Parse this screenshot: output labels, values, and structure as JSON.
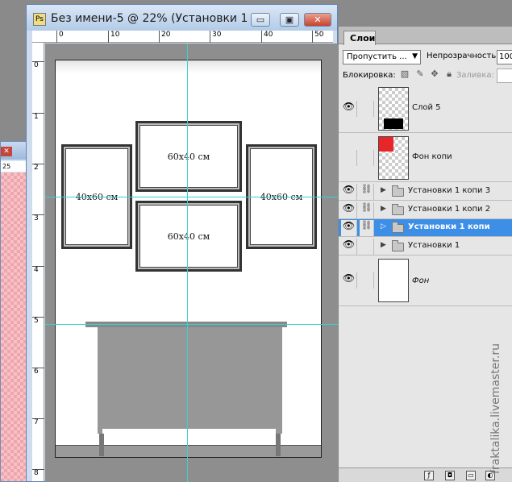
{
  "document": {
    "title": "Без имени-5 @ 22% (Установки 1 ...",
    "minimize_glyph": "▭",
    "maximize_glyph": "▣",
    "close_glyph": "✕",
    "ruler_h": [
      "0",
      "10",
      "20",
      "30",
      "40",
      "50"
    ],
    "ruler_v": [
      "0",
      "1",
      "2",
      "3",
      "4",
      "5",
      "6",
      "7",
      "8"
    ],
    "frames": [
      {
        "label": "40x60 см"
      },
      {
        "label": "60x40 см"
      },
      {
        "label": "60x40 см"
      },
      {
        "label": "40x60 см"
      }
    ]
  },
  "background_window": {
    "close_glyph": "✕",
    "ruler_value": "25"
  },
  "layers_panel": {
    "tab_label": "Слои",
    "blend_mode": "Пропустить ...",
    "opacity_label": "Непрозрачность:",
    "opacity_value": "100",
    "lock_label": "Блокировка:",
    "fill_label": "Заливка:",
    "layers": [
      {
        "name": "Слой 5",
        "visible": true,
        "type": "image",
        "thumb_color": "#000000"
      },
      {
        "name": "Фон копи",
        "visible": false,
        "type": "image",
        "thumb_color": "#e8262a"
      },
      {
        "name": "Установки 1 копи 3",
        "visible": true,
        "type": "group",
        "selected": false
      },
      {
        "name": "Установки 1 копи 2",
        "visible": true,
        "type": "group",
        "selected": false
      },
      {
        "name": "Установки 1 копи",
        "visible": true,
        "type": "group",
        "selected": true
      },
      {
        "name": "Установки 1",
        "visible": true,
        "type": "group",
        "selected": false
      },
      {
        "name": "Фон",
        "visible": true,
        "type": "background"
      }
    ]
  },
  "watermark": "fraktalika.livemaster.ru",
  "colors": {
    "selection": "#3d8ee7",
    "guide": "#34d3d3"
  }
}
